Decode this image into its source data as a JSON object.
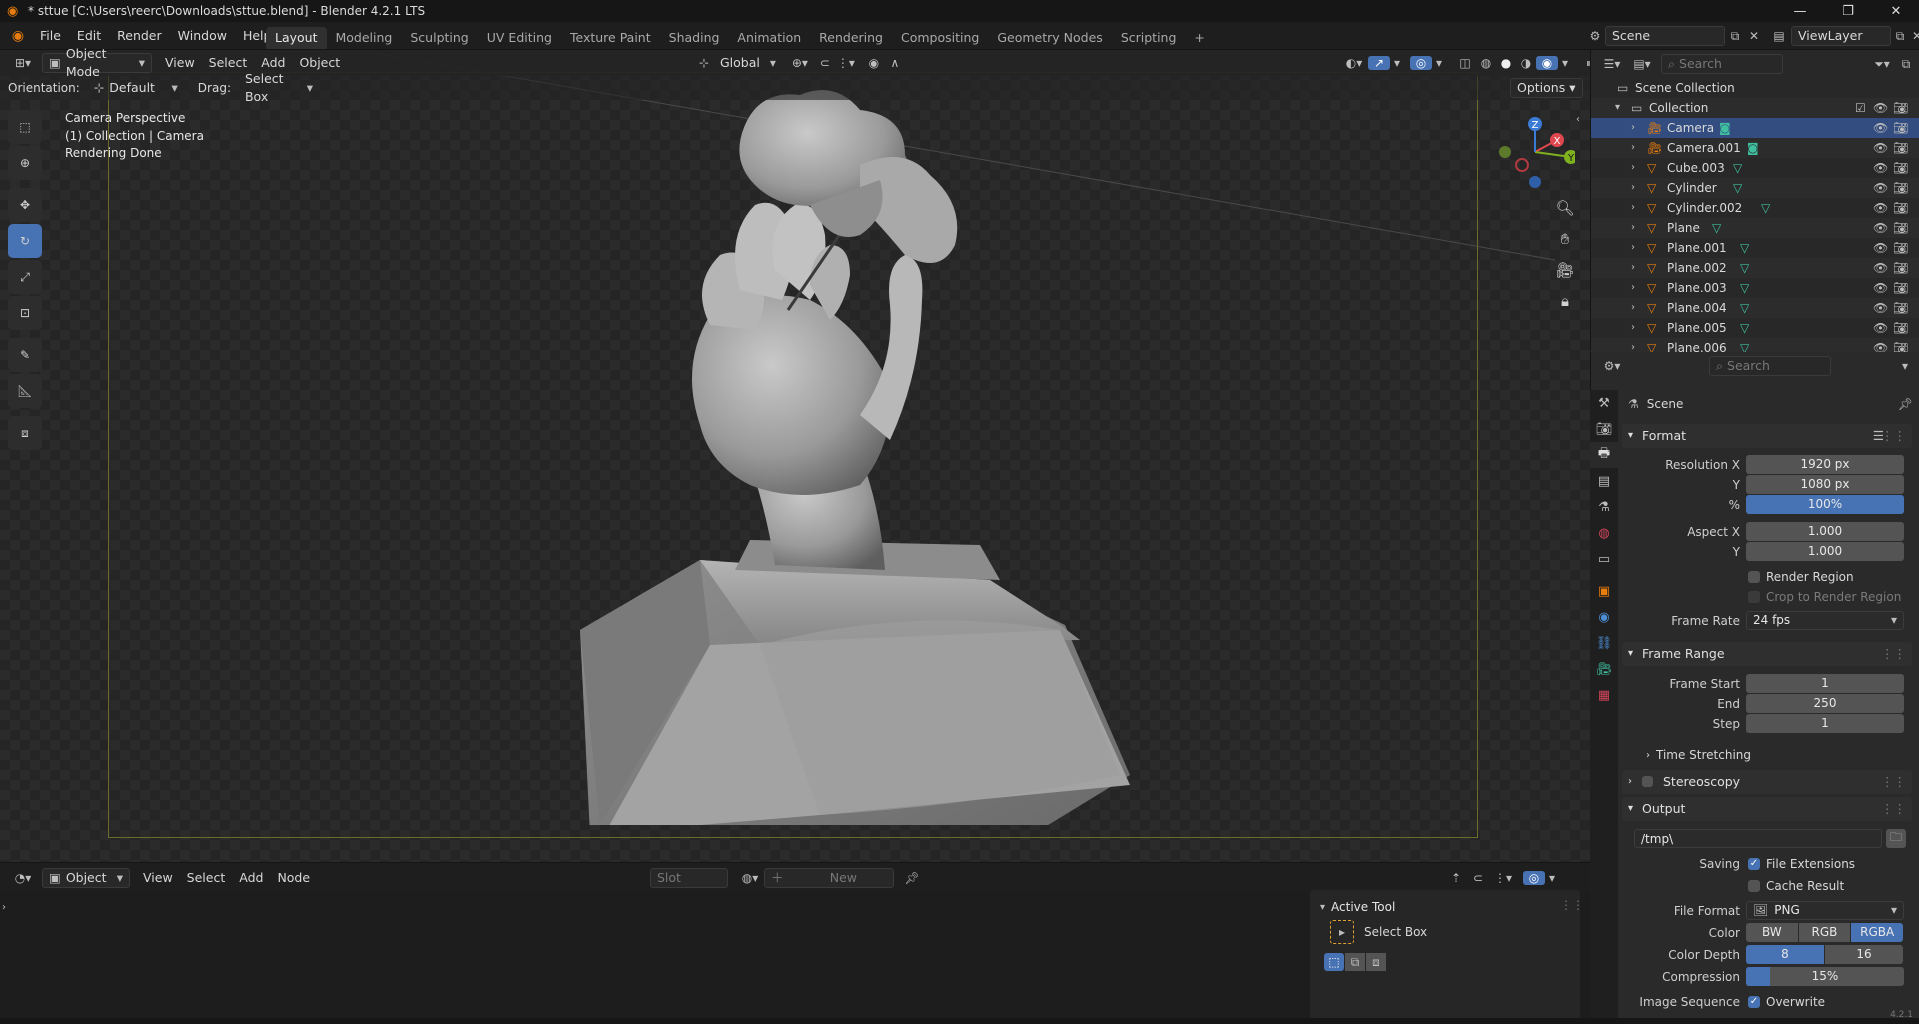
{
  "titlebar": {
    "title": "* sttue [C:\\Users\\reerc\\Downloads\\sttue.blend] - Blender 4.2.1 LTS",
    "minimize": "—",
    "maximize": "❐",
    "close": "✕"
  },
  "menubar": {
    "menus": [
      "File",
      "Edit",
      "Render",
      "Window",
      "Help"
    ],
    "workspaces": [
      "Layout",
      "Modeling",
      "Sculpting",
      "UV Editing",
      "Texture Paint",
      "Shading",
      "Animation",
      "Rendering",
      "Compositing",
      "Geometry Nodes",
      "Scripting"
    ],
    "active_workspace": "Layout",
    "add_tab": "+",
    "scene": "Scene",
    "view_layer": "ViewLayer"
  },
  "viewport": {
    "mode": "Object Mode",
    "menus": [
      "View",
      "Select",
      "Add",
      "Object"
    ],
    "transform_orientation": "Global",
    "orientation_label": "Orientation:",
    "orientation_value": "Default",
    "drag_label": "Drag:",
    "drag_value": "Select Box",
    "options": "Options",
    "info": [
      "Camera Perspective",
      "(1) Collection | Camera",
      "Rendering Done"
    ],
    "gizmo_axes": {
      "x": "X",
      "y": "Y",
      "z": "Z"
    },
    "axis_colors": {
      "x": "#e0484f",
      "y": "#7fb11f",
      "z": "#3a7bd5"
    }
  },
  "outliner": {
    "search_placeholder": "Search",
    "scene_collection": "Scene Collection",
    "collection": "Collection",
    "objects": [
      {
        "name": "Camera",
        "type": "camera",
        "selected": true
      },
      {
        "name": "Camera.001",
        "type": "camera",
        "selected": false
      },
      {
        "name": "Cube.003",
        "type": "mesh",
        "selected": false
      },
      {
        "name": "Cylinder",
        "type": "mesh",
        "selected": false
      },
      {
        "name": "Cylinder.002",
        "type": "mesh",
        "selected": false
      },
      {
        "name": "Plane",
        "type": "mesh",
        "selected": false
      },
      {
        "name": "Plane.001",
        "type": "mesh",
        "selected": false
      },
      {
        "name": "Plane.002",
        "type": "mesh",
        "selected": false
      },
      {
        "name": "Plane.003",
        "type": "mesh",
        "selected": false
      },
      {
        "name": "Plane.004",
        "type": "mesh",
        "selected": false
      },
      {
        "name": "Plane.005",
        "type": "mesh",
        "selected": false
      },
      {
        "name": "Plane.006",
        "type": "mesh",
        "selected": false
      }
    ]
  },
  "properties": {
    "search_placeholder": "Search",
    "context": "Scene",
    "format": {
      "title": "Format",
      "resolution_x_label": "Resolution X",
      "resolution_x": "1920 px",
      "resolution_y_label": "Y",
      "resolution_y": "1080 px",
      "percent_label": "%",
      "percent": "100%",
      "aspect_x_label": "Aspect X",
      "aspect_x": "1.000",
      "aspect_y_label": "Y",
      "aspect_y": "1.000",
      "render_region": "Render Region",
      "crop_region": "Crop to Render Region",
      "frame_rate_label": "Frame Rate",
      "frame_rate": "24 fps"
    },
    "frame_range": {
      "title": "Frame Range",
      "start_label": "Frame Start",
      "start": "1",
      "end_label": "End",
      "end": "250",
      "step_label": "Step",
      "step": "1",
      "time_stretching": "Time Stretching"
    },
    "stereoscopy": "Stereoscopy",
    "output": {
      "title": "Output",
      "path": "/tmp\\",
      "saving_label": "Saving",
      "file_extensions": "File Extensions",
      "cache_result": "Cache Result",
      "file_format_label": "File Format",
      "file_format": "PNG",
      "color_label": "Color",
      "color_options": [
        "BW",
        "RGB",
        "RGBA"
      ],
      "color_selected": "RGBA",
      "color_depth_label": "Color Depth",
      "color_depth_options": [
        "8",
        "16"
      ],
      "color_depth_selected": "8",
      "compression_label": "Compression",
      "compression": "15%",
      "compression_value": 0.15,
      "image_sequence_label": "Image Sequence",
      "overwrite": "Overwrite"
    }
  },
  "bottom_editor": {
    "mode": "Object",
    "menus": [
      "View",
      "Select",
      "Add",
      "Node"
    ],
    "slot": "Slot",
    "new": "New"
  },
  "active_tool": {
    "title": "Active Tool",
    "tool": "Select Box"
  },
  "statusbar": {
    "version": "4.2.1"
  }
}
